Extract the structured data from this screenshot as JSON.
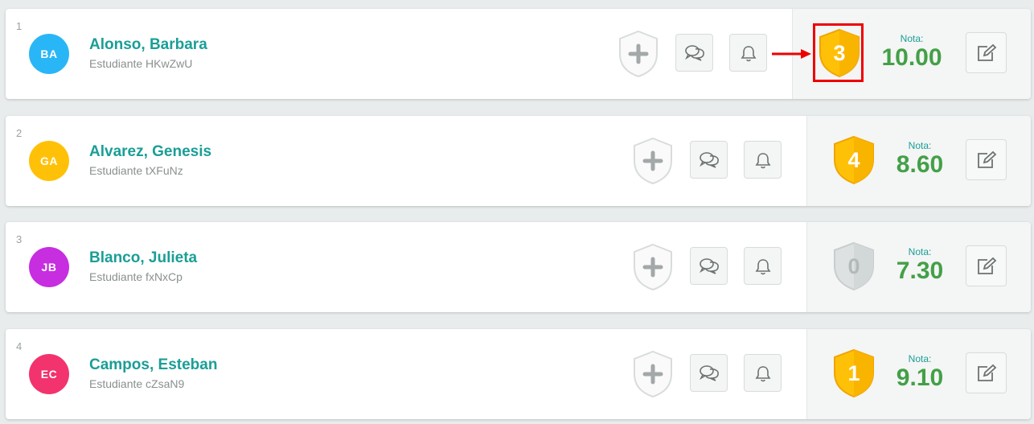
{
  "students": [
    {
      "index": "1",
      "initials": "BA",
      "name": "Alonso, Barbara",
      "subtitle": "Estudiante HKwZwU",
      "avatar_color": "#29b6f6",
      "medal_value": "3",
      "medal_style": "gold",
      "nota_label": "Nota:",
      "grade": "10.00"
    },
    {
      "index": "2",
      "initials": "GA",
      "name": "Alvarez, Genesis",
      "subtitle": "Estudiante tXFuNz",
      "avatar_color": "#ffc107",
      "medal_value": "4",
      "medal_style": "gold",
      "nota_label": "Nota:",
      "grade": "8.60"
    },
    {
      "index": "3",
      "initials": "JB",
      "name": "Blanco, Julieta",
      "subtitle": "Estudiante fxNxCp",
      "avatar_color": "#c62ee0",
      "medal_value": "0",
      "medal_style": "gray",
      "nota_label": "Nota:",
      "grade": "7.30"
    },
    {
      "index": "4",
      "initials": "EC",
      "name": "Campos, Esteban",
      "subtitle": "Estudiante cZsaN9",
      "avatar_color": "#f2336e",
      "medal_value": "1",
      "medal_style": "gold",
      "nota_label": "Nota:",
      "grade": "9.10"
    }
  ],
  "icons": {
    "add_points": "plus-shield-icon",
    "comment": "chat-bubbles-icon",
    "notify": "bell-icon",
    "medal": "shield-medal-icon",
    "edit": "edit-icon",
    "annotation": "red-arrow-highlight"
  },
  "colors": {
    "accent_teal": "#1a9e96",
    "grade_green": "#43a047",
    "medal_gold": "#ffc107",
    "medal_gray": "#d5d9d9",
    "annotation_red": "#ee0000"
  }
}
